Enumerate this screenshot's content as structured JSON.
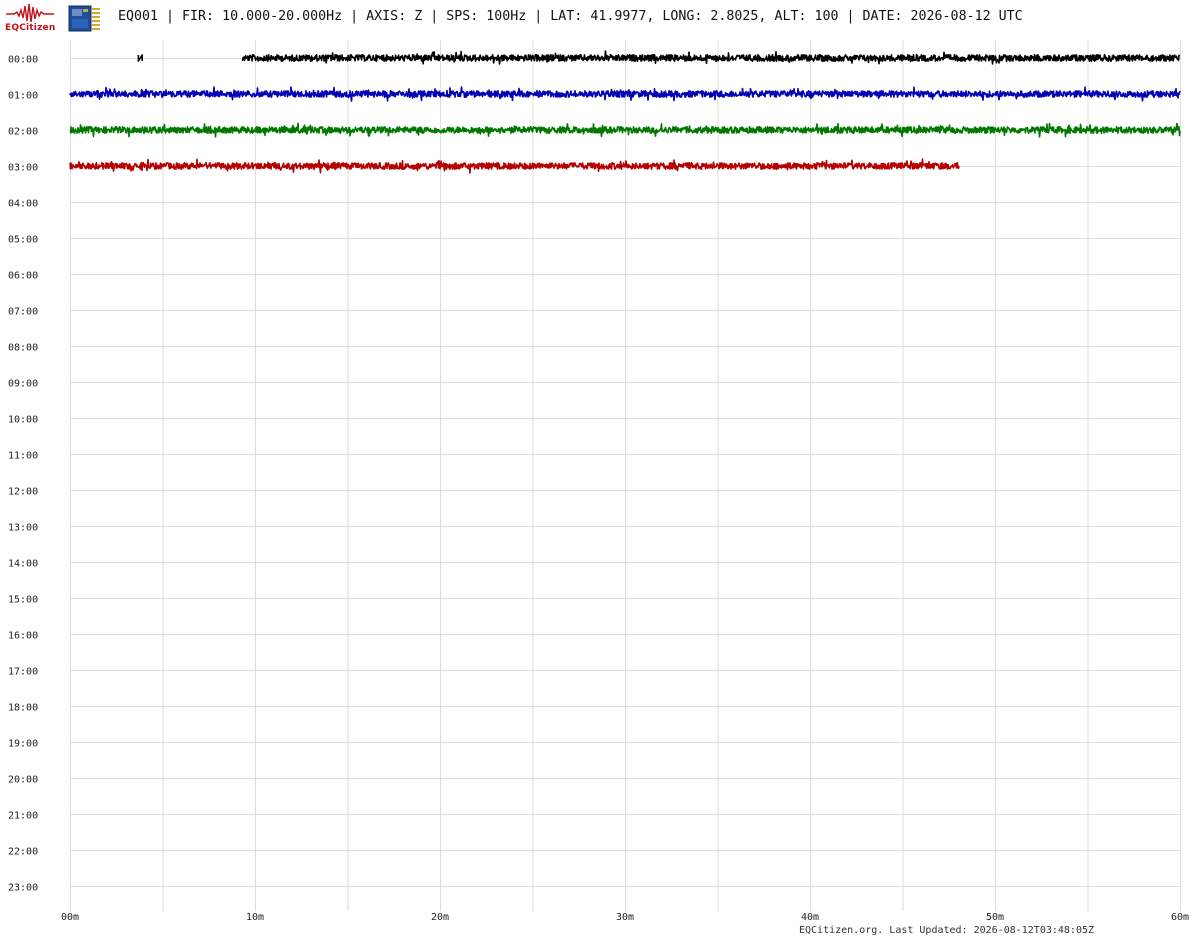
{
  "header": {
    "logo_text": "EQCitizen",
    "title": "EQ001 | FIR: 10.000-20.000Hz | AXIS: Z | SPS: 100Hz | LAT: 41.9977, LONG: 2.8025, ALT: 100 | DATE: 2026-08-12 UTC"
  },
  "footer": {
    "text": "EQCitizen.org. Last Updated: 2026-08-12T03:48:05Z"
  },
  "icons": {
    "logo": "seismograph-wave-icon",
    "device": "sensor-chip-icon"
  },
  "colors": {
    "logo_red": "#c0141c",
    "grid": "#dddddd",
    "trace_cycle": [
      "#000000",
      "#0000b4",
      "#007800",
      "#b40000"
    ]
  },
  "chart_data": {
    "type": "line",
    "description_type": "helicorder",
    "title": "",
    "xlabel": "",
    "ylabel": "",
    "grid": true,
    "y_tick_labels": [
      "00:00",
      "01:00",
      "02:00",
      "03:00",
      "04:00",
      "05:00",
      "06:00",
      "07:00",
      "08:00",
      "09:00",
      "10:00",
      "11:00",
      "12:00",
      "13:00",
      "14:00",
      "15:00",
      "16:00",
      "17:00",
      "18:00",
      "19:00",
      "20:00",
      "21:00",
      "22:00",
      "23:00"
    ],
    "x_tick_labels": [
      "00m",
      "10m",
      "20m",
      "30m",
      "40m",
      "50m",
      "60m"
    ],
    "xlim_minutes": [
      0,
      60
    ],
    "x_grid_minutes": [
      0,
      5,
      10,
      15,
      20,
      25,
      30,
      35,
      40,
      45,
      50,
      55,
      60
    ],
    "series": [
      {
        "hour": "00:00",
        "color": "#000000",
        "segments": [
          [
            3.7,
            3.9
          ],
          [
            9.3,
            60
          ]
        ]
      },
      {
        "hour": "01:00",
        "color": "#0000b4",
        "segments": [
          [
            0,
            60
          ]
        ]
      },
      {
        "hour": "02:00",
        "color": "#007800",
        "segments": [
          [
            0,
            60
          ]
        ]
      },
      {
        "hour": "03:00",
        "color": "#b40000",
        "segments": [
          [
            0,
            48.1
          ]
        ]
      }
    ]
  }
}
